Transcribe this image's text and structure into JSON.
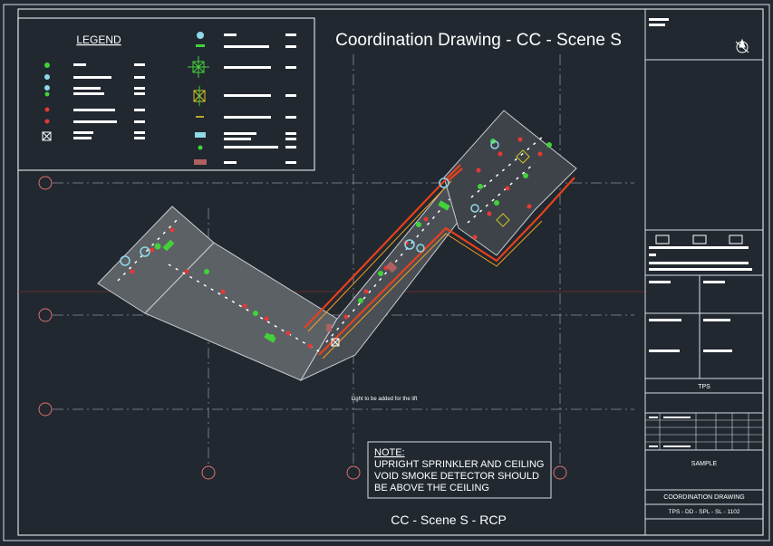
{
  "drawing": {
    "title": "Coordination Drawing - CC - Scene S",
    "subtitle": "CC - Scene S - RCP",
    "lift_note": "Light to be added for the lift"
  },
  "legend": {
    "heading": "LEGEND"
  },
  "note": {
    "heading": "NOTE:",
    "lines": [
      "UPRIGHT SPRINKLER AND CEILING",
      "VOID SMOKE DETECTOR SHOULD",
      "BE ABOVE THE CEILING"
    ]
  },
  "title_block": {
    "company": "TPS",
    "status": "SAMPLE",
    "drawing_name": "COORDINATION DRAWING",
    "drawing_number": "TPS - DD - SPL - SL - 1102"
  },
  "colors": {
    "background": "#212830",
    "line": "#d8dde2",
    "wall": "#e8401c",
    "sprinkler": "#e53935",
    "detector": "#43d13a",
    "diffuser": "#8fd8e8"
  }
}
